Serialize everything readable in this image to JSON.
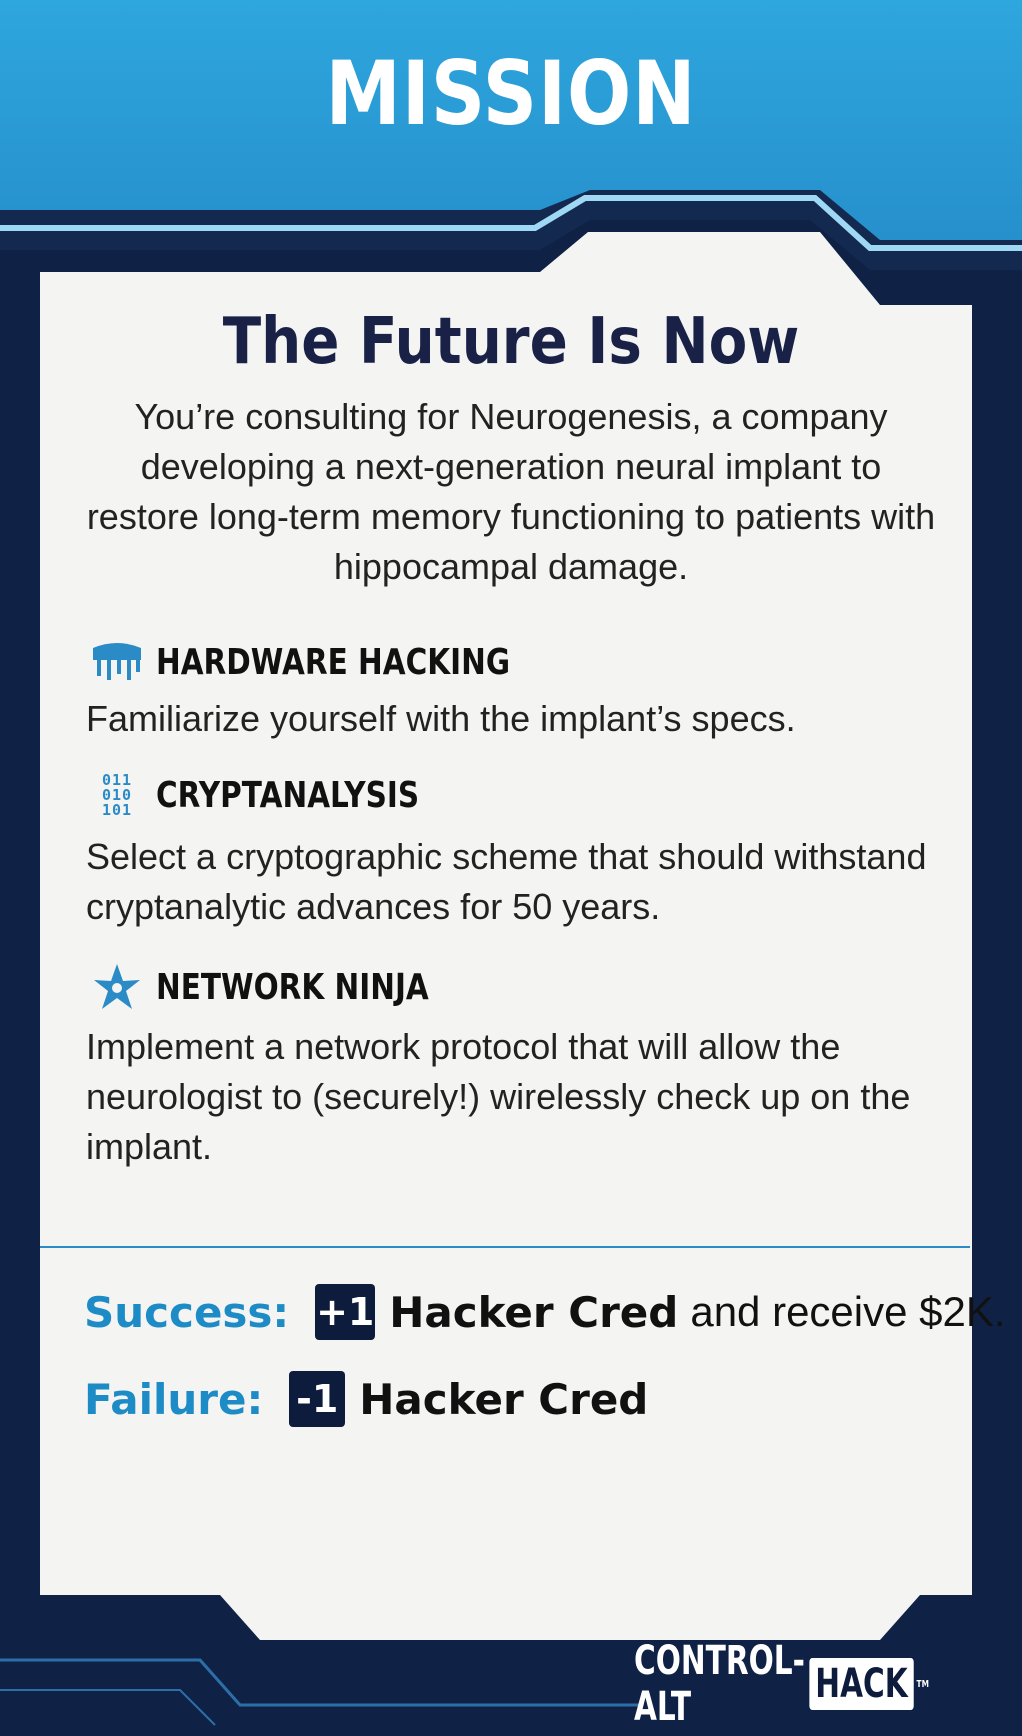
{
  "header": {
    "title": "MISSION"
  },
  "mission": {
    "title": "The Future Is Now",
    "intro": "You’re consulting for Neurogenesis, a company developing a next-generation neural implant to restore long-term memory functioning to patients with hippocampal damage."
  },
  "skills": [
    {
      "icon": "chip-icon",
      "name": "HARDWARE HACKING",
      "desc": "Familiarize yourself with the implant’s specs."
    },
    {
      "icon": "binary-icon",
      "name": "CRYPTANALYSIS",
      "icon_text": [
        "011",
        "010",
        "101"
      ],
      "desc": "Select a cryptographic scheme that should withstand cryptanalytic advances for 50 years."
    },
    {
      "icon": "ninja-star-icon",
      "name": "NETWORK NINJA",
      "desc": "Implement a network protocol that will allow the neurologist to (securely!) wirelessly check up on the implant."
    }
  ],
  "results": {
    "success": {
      "label": "Success:",
      "badge": "+1",
      "cred": "Hacker Cred",
      "tail": "and receive $2K."
    },
    "failure": {
      "label": "Failure:",
      "badge": "-1",
      "cred": "Hacker Cred"
    }
  },
  "brand": {
    "control_alt": "CONTROL-ALT",
    "hack": "HACK",
    "tm": "TM"
  },
  "colors": {
    "header_blue": "#2d9fd9",
    "frame_navy": "#0e2347",
    "panel": "#f4f4f2",
    "accent": "#1d8bc5"
  }
}
